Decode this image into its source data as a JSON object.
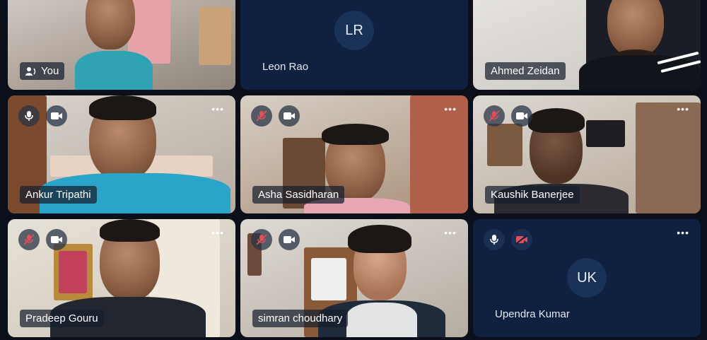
{
  "participants": [
    {
      "name": "You",
      "type": "video",
      "icon": "speaker-icon"
    },
    {
      "name": "Leon Rao",
      "type": "avatar",
      "initials": "LR"
    },
    {
      "name": "Ahmed Zeidan",
      "type": "video"
    },
    {
      "name": "Ankur Tripathi",
      "type": "video",
      "mic": "on",
      "camera": "on"
    },
    {
      "name": "Asha Sasidharan",
      "type": "video",
      "mic": "muted",
      "camera": "on"
    },
    {
      "name": "Kaushik Banerjee",
      "type": "video",
      "mic": "muted",
      "camera": "on"
    },
    {
      "name": "Pradeep Gouru",
      "type": "video",
      "mic": "muted",
      "camera": "on"
    },
    {
      "name": "simran choudhary",
      "type": "video",
      "mic": "muted",
      "camera": "on"
    },
    {
      "name": "Upendra Kumar",
      "type": "avatar",
      "initials": "UK",
      "mic": "on",
      "camera": "off"
    }
  ],
  "more_menu_glyph": "•••",
  "colors": {
    "background": "#0b0f1a",
    "avatar_tile": "#0f2040",
    "muted_red": "#e0505a"
  }
}
